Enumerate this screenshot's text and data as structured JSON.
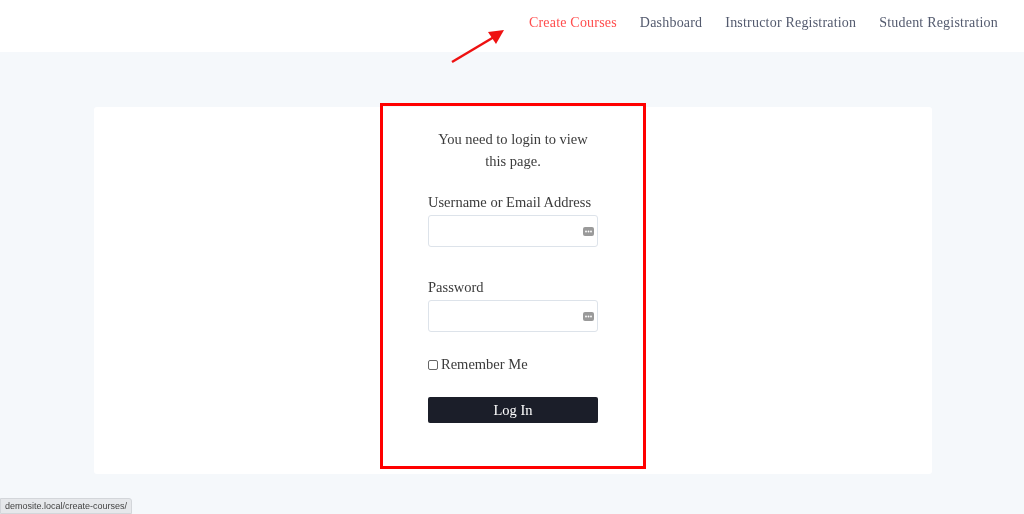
{
  "nav": [
    {
      "label": "Create Courses",
      "selected": true
    },
    {
      "label": "Dashboard",
      "selected": false
    },
    {
      "label": "Instructor Registration",
      "selected": false
    },
    {
      "label": "Student Registration",
      "selected": false
    }
  ],
  "login": {
    "message": "You need to login to view this page.",
    "username_label": "Username or Email Address",
    "password_label": "Password",
    "remember": {
      "label": "Remember Me",
      "checked": false
    },
    "button": "Log In"
  },
  "status_bar": "demosite.local/create-courses/"
}
